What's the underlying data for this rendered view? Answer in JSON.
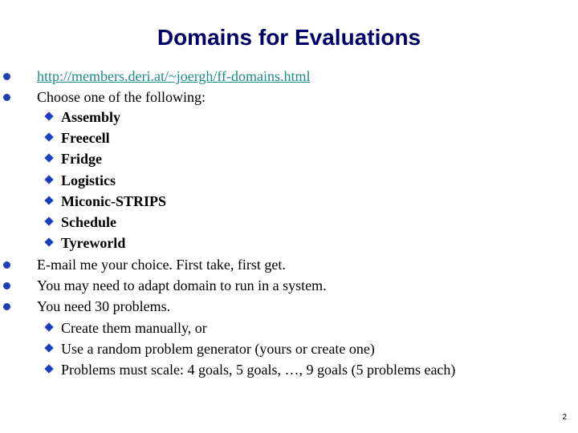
{
  "slide": {
    "title": "Domains for Evaluations",
    "page_number": "2",
    "link_color": "#1f8a8a",
    "title_color": "#000066",
    "bullet_color": "#1f3fb5"
  },
  "bullets": {
    "link": "http://members.deri.at/~joergh/ff-domains.html",
    "choose": "Choose one of the following:",
    "domains": [
      "Assembly",
      "Freecell",
      "Fridge",
      "Logistics",
      "Miconic-STRIPS",
      "Schedule",
      "Tyreworld"
    ],
    "email": "E-mail me your choice. First take, first get.",
    "adapt": "You may need to adapt domain to run in a system.",
    "problems": "You need 30 problems.",
    "problem_items": [
      "Create them manually, or",
      "Use a random problem generator (yours or create one)",
      "Problems must scale: 4 goals, 5 goals, …, 9 goals (5 problems each)"
    ]
  }
}
